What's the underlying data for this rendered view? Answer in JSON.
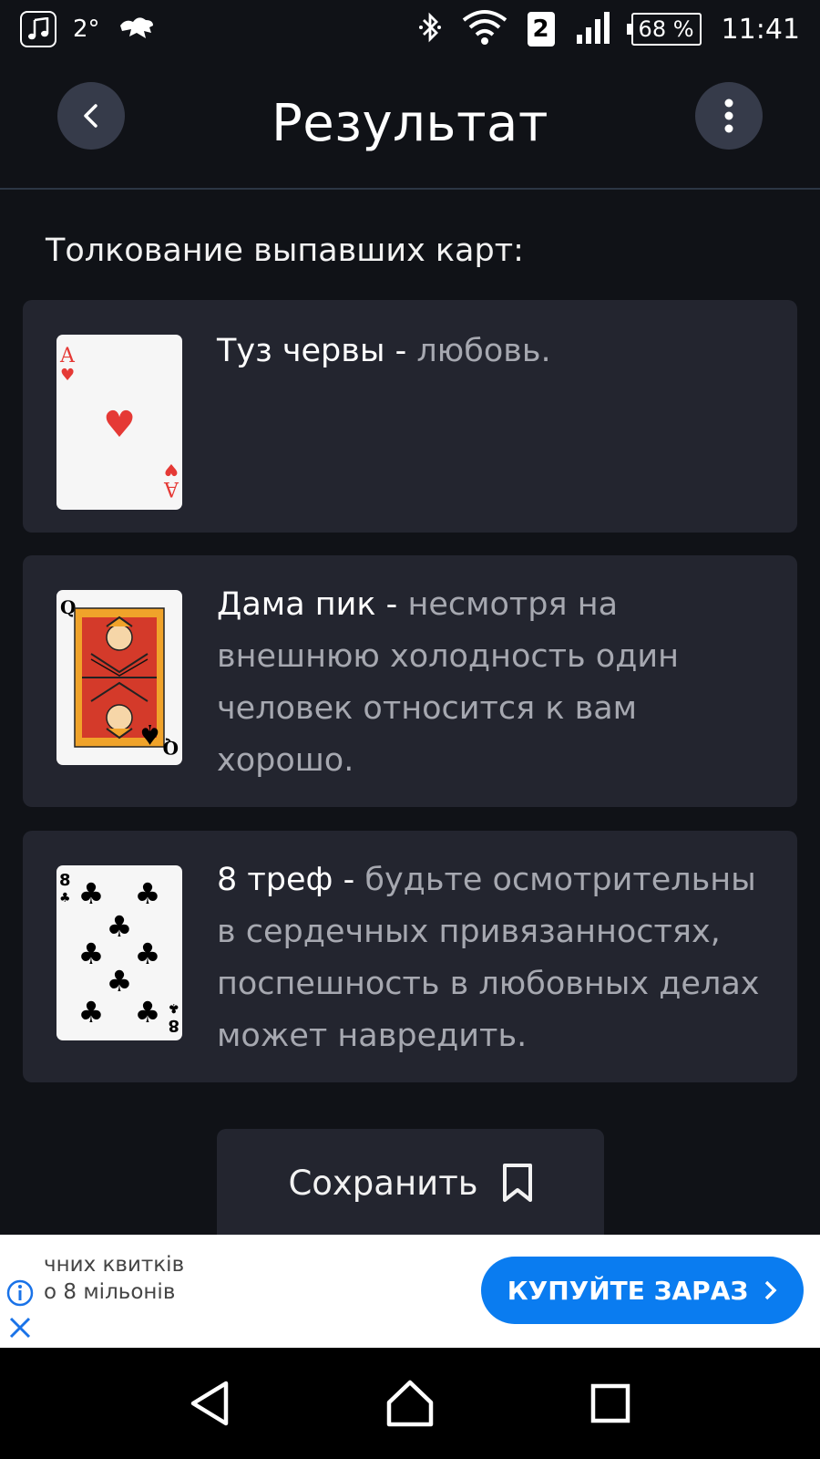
{
  "status_bar": {
    "temperature": "2°",
    "sim_slot": "2",
    "battery": "68 %",
    "time": "11:41",
    "icons": [
      "music-icon",
      "weather-icon",
      "bluetooth-icon",
      "wifi-icon",
      "signal-icon",
      "battery-icon"
    ]
  },
  "appbar": {
    "title": "Результат",
    "back_icon": "chevron-left-icon",
    "menu_icon": "more-vertical-icon"
  },
  "section_title": "Толкование выпавших карт:",
  "cards": [
    {
      "name": "Туз червы",
      "dash": " - ",
      "meaning": "любовь.",
      "rank": "A",
      "suit": "♥",
      "suit_color": "#e53935"
    },
    {
      "name": "Дама пик",
      "dash": " - ",
      "meaning": "несмотря на внешнюю холодность один человек относится к вам хорошо.",
      "rank": "Q",
      "suit": "♠",
      "suit_color": "#000000"
    },
    {
      "name": "8 треф",
      "dash": " - ",
      "meaning": "будьте осмотрительны в сердечных привязанностях, поспешность в любовных делах может навредить.",
      "rank": "8",
      "suit": "♣",
      "suit_color": "#000000"
    }
  ],
  "save_button": {
    "label": "Сохранить",
    "icon": "bookmark-icon"
  },
  "ad": {
    "line1": "чних квитків",
    "line2": "о 8 мільонів",
    "cta": "КУПУЙТЕ ЗАРАЗ",
    "cta_color": "#0a7cf0"
  },
  "navbar": {
    "icons": [
      "back-triangle-icon",
      "home-icon",
      "recents-square-icon"
    ]
  }
}
